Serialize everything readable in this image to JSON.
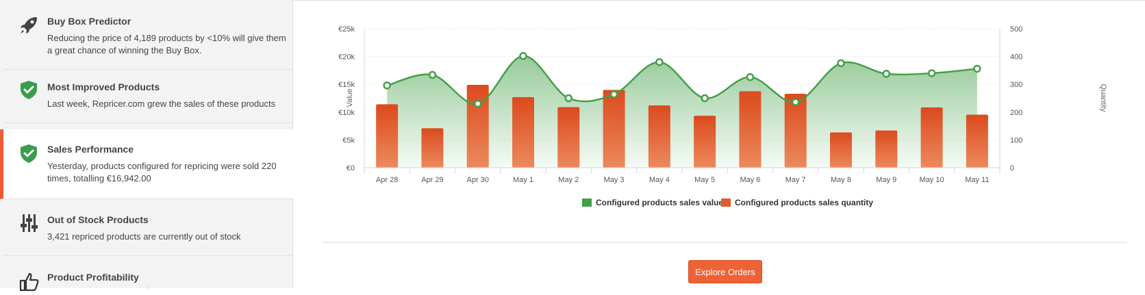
{
  "sidebar": {
    "items": [
      {
        "title": "Buy Box Predictor",
        "desc": "Reducing the price of 4,189 products by <10% will give them a great chance of winning the Buy Box.",
        "icon": "rocket-icon"
      },
      {
        "title": "Most Improved Products",
        "desc": "Last week, Repricer.com grew the sales of these products",
        "icon": "shield-check-icon"
      },
      {
        "title": "Sales Performance",
        "desc": "Yesterday, products configured for repricing were sold 220 times, totalling €16,942.00",
        "icon": "shield-check-icon"
      },
      {
        "title": "Out of Stock Products",
        "desc": "3,421 repriced products are currently out of stock",
        "icon": "sliders-icon"
      },
      {
        "title": "Product Profitability",
        "desc": "",
        "icon": "thumbs-up-icon"
      }
    ]
  },
  "colors": {
    "accent": "#ee5a32",
    "value_series": "#43a047",
    "quantity_series": "#e55a2b"
  },
  "chart_data": {
    "type": "bar",
    "categories": [
      "Apr 28",
      "Apr 29",
      "Apr 30",
      "May 1",
      "May 2",
      "May 3",
      "May 4",
      "May 5",
      "May 6",
      "May 7",
      "May 8",
      "May 9",
      "May 10",
      "May 11"
    ],
    "series": [
      {
        "name": "Configured products sales value",
        "type": "area",
        "axis": "left",
        "values": [
          14800,
          16700,
          11500,
          20100,
          12500,
          13200,
          19000,
          12500,
          16300,
          11800,
          18800,
          16900,
          17000,
          17800
        ]
      },
      {
        "name": "Configured products sales quantity",
        "type": "bar",
        "axis": "right",
        "values": [
          228,
          142,
          298,
          254,
          218,
          280,
          224,
          187,
          275,
          266,
          127,
          134,
          217,
          191
        ]
      }
    ],
    "ylabel": "Value",
    "y2label": "Quantity",
    "ylim": [
      0,
      25000
    ],
    "y2lim": [
      0,
      500
    ],
    "yticks": [
      "€0",
      "€5k",
      "€10k",
      "€15k",
      "€20k",
      "€25k"
    ],
    "y2ticks": [
      "0",
      "100",
      "200",
      "300",
      "400",
      "500"
    ],
    "legend": "bottom",
    "grid": true
  },
  "button": {
    "label": "Explore Orders"
  }
}
